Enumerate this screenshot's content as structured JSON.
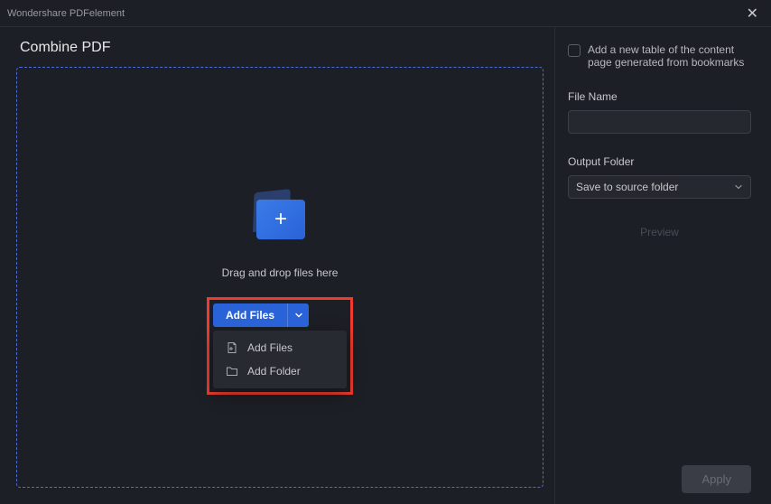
{
  "window": {
    "title": "Wondershare PDFelement"
  },
  "page": {
    "title": "Combine PDF"
  },
  "dropzone": {
    "hint": "Drag and drop files here",
    "add_button": "Add Files",
    "menu": {
      "add_files": "Add Files",
      "add_folder": "Add Folder"
    }
  },
  "sidebar": {
    "checkbox_label": "Add a new table of the content page generated from bookmarks",
    "file_name_label": "File Name",
    "file_name_value": "",
    "output_folder_label": "Output Folder",
    "output_folder_selected": "Save to source folder",
    "preview_label": "Preview"
  },
  "footer": {
    "apply_label": "Apply"
  }
}
